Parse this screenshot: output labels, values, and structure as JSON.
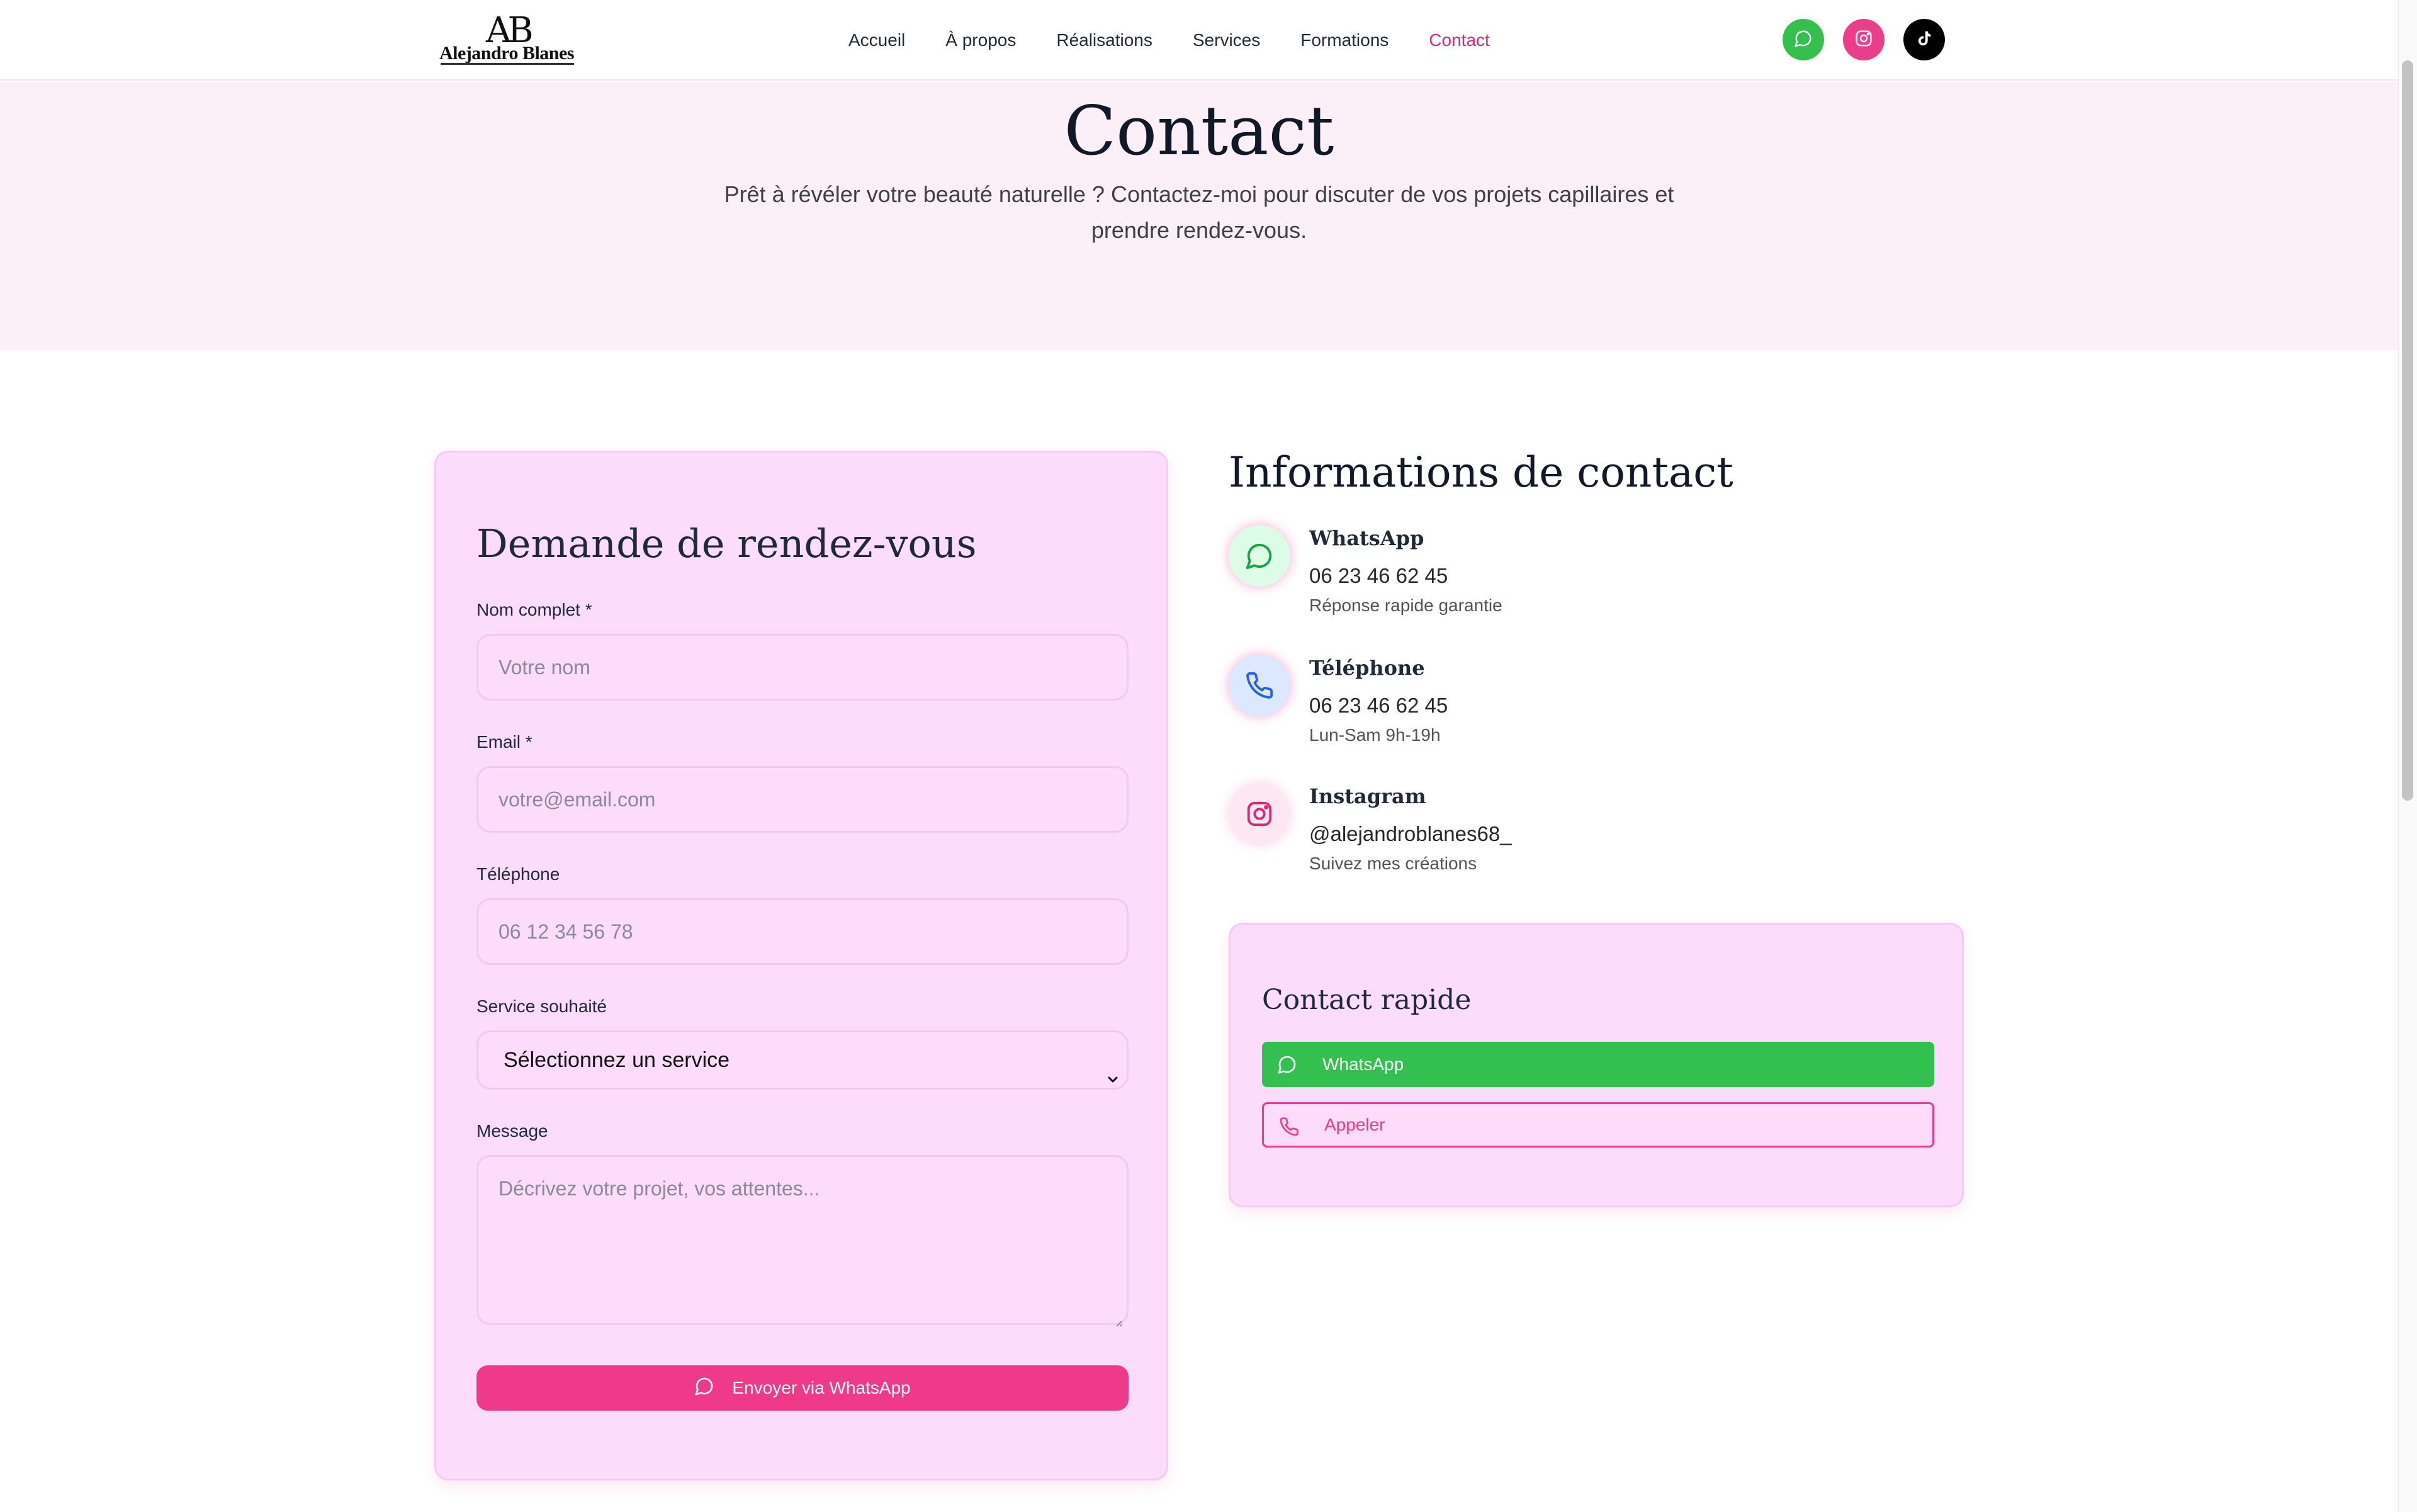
{
  "brand": {
    "monogram": "AB",
    "name": "Alejandro Blanes"
  },
  "nav": {
    "items": [
      {
        "label": "Accueil"
      },
      {
        "label": "À propos"
      },
      {
        "label": "Réalisations"
      },
      {
        "label": "Services"
      },
      {
        "label": "Formations"
      },
      {
        "label": "Contact",
        "active": true
      }
    ]
  },
  "social": [
    {
      "icon": "whatsapp-icon",
      "color": "#34c04f"
    },
    {
      "icon": "instagram-icon",
      "color": "#ec3d8a"
    },
    {
      "icon": "tiktok-icon",
      "color": "#000000"
    }
  ],
  "hero": {
    "title": "Contact",
    "subtitle": "Prêt à révéler votre beauté naturelle ? Contactez-moi pour discuter de vos projets capillaires et prendre rendez-vous."
  },
  "form": {
    "title": "Demande de rendez-vous",
    "name_label": "Nom complet *",
    "name_placeholder": "Votre nom",
    "email_label": "Email *",
    "email_placeholder": "votre@email.com",
    "phone_label": "Téléphone",
    "phone_placeholder": "06 12 34 56 78",
    "service_label": "Service souhaité",
    "service_selected": "Sélectionnez un service",
    "message_label": "Message",
    "message_placeholder": "Décrivez votre projet, vos attentes...",
    "submit_label": "Envoyer via WhatsApp"
  },
  "info": {
    "title": "Informations de contact",
    "items": [
      {
        "name": "WhatsApp",
        "value": "06 23 46 62 45",
        "note": "Réponse rapide garantie",
        "icon": "whatsapp-icon"
      },
      {
        "name": "Téléphone",
        "value": "06 23 46 62 45",
        "note": "Lun-Sam 9h-19h",
        "icon": "phone-icon"
      },
      {
        "name": "Instagram",
        "value": "@alejandroblanes68_",
        "note": "Suivez mes créations",
        "icon": "instagram-icon"
      }
    ]
  },
  "quick": {
    "title": "Contact rapide",
    "whatsapp_label": "WhatsApp",
    "call_label": "Appeler"
  },
  "colors": {
    "accent": "#db2777",
    "button_pink": "#ee3a88",
    "whatsapp_green": "#34c04f",
    "card_bg": "#fcdcfb",
    "hero_bg": "#fcf0f8"
  }
}
